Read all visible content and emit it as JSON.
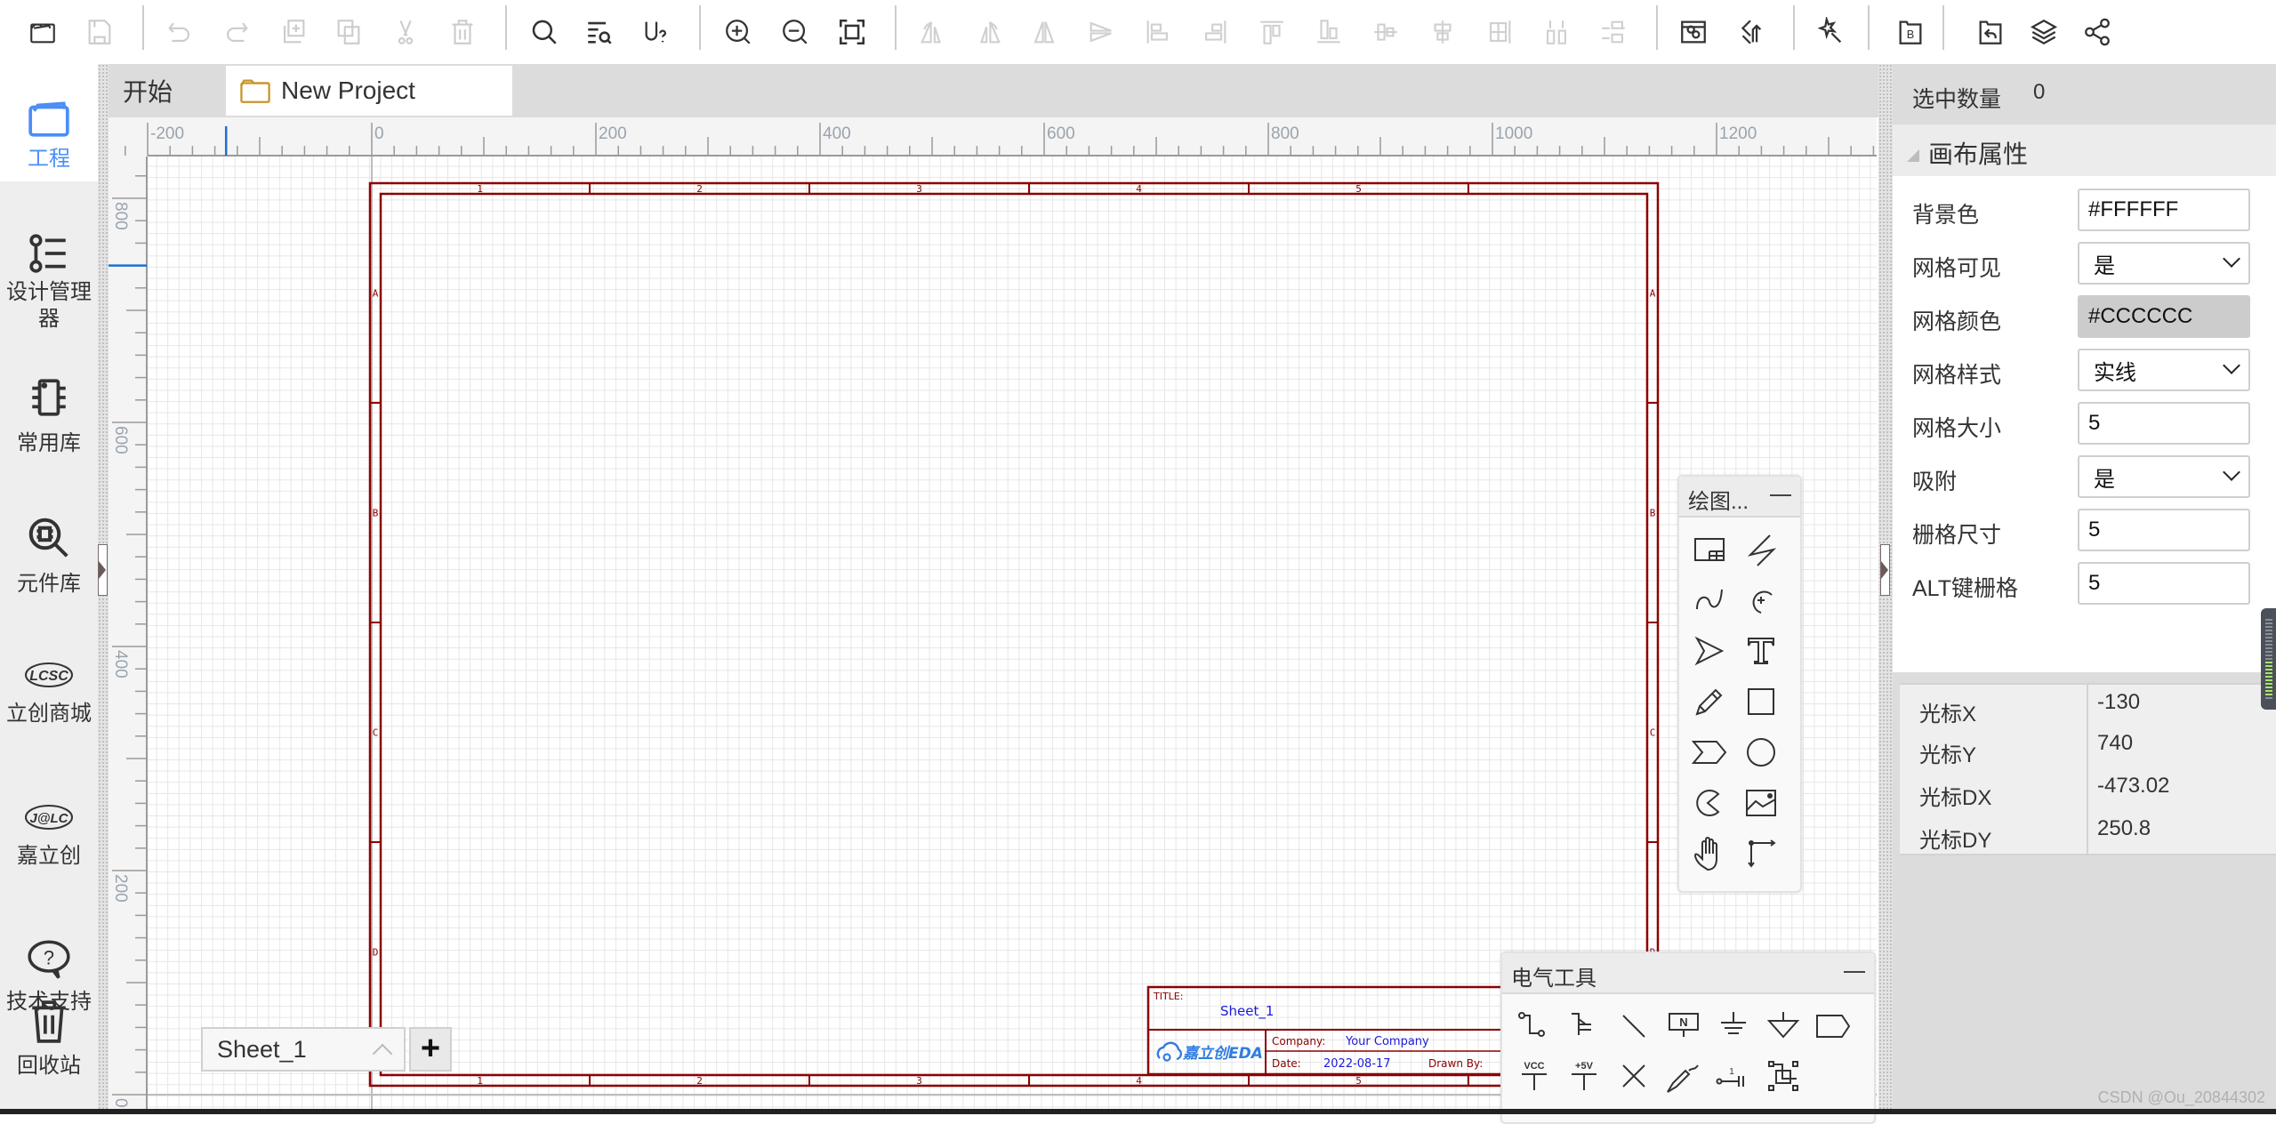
{
  "toolbar": {
    "groups": [
      [
        "folder-open-icon",
        "save-icon"
      ],
      [
        "undo-icon",
        "redo-icon",
        "duplicate-icon",
        "copy-icon",
        "cut-icon",
        "delete-icon"
      ],
      [
        "search-icon",
        "find-component-icon",
        "unknown-symbol-icon"
      ],
      [
        "zoom-in-icon",
        "zoom-out-icon",
        "fit-view-icon"
      ],
      [
        "rotate-left-icon",
        "rotate-right-icon",
        "flip-horizontal-icon",
        "flip-vertical-icon",
        "align-left-icon",
        "align-right-icon",
        "align-top-icon",
        "align-bottom-icon",
        "align-center-h-icon",
        "align-center-v-icon",
        "distribute-h-icon",
        "distribute-v-icon",
        "distribute-grid-icon"
      ],
      [
        "photo-export-icon",
        "update-layers-icon"
      ],
      [
        "magic-wand-icon"
      ],
      [
        "bom-icon"
      ],
      [
        "import-changes-icon",
        "layers-icon",
        "share-icon"
      ]
    ]
  },
  "sidebar": {
    "items": [
      {
        "label": "工程",
        "icon": "project-folder-icon",
        "active": true
      },
      {
        "label": "设计管理器",
        "icon": "design-manager-icon"
      },
      {
        "label": "常用库",
        "icon": "common-library-icon"
      },
      {
        "label": "元件库",
        "icon": "component-search-icon"
      },
      {
        "label": "立创商城",
        "icon": "lcsc-logo-icon",
        "logo_text": "LCSC"
      },
      {
        "label": "嘉立创",
        "icon": "jlc-logo-icon",
        "logo_text": "J@LC"
      },
      {
        "label": "技术支持",
        "icon": "help-bubble-icon"
      },
      {
        "label": "回收站",
        "icon": "trash-icon"
      }
    ]
  },
  "tabs": [
    {
      "label": "开始",
      "active": false
    },
    {
      "label": "New Project",
      "active": true,
      "icon": "folder-icon"
    }
  ],
  "ruler": {
    "top_labels": [
      "-200",
      "0",
      "200",
      "400",
      "600",
      "800",
      "1000",
      "1200"
    ],
    "left_labels": [
      "800",
      "600",
      "400",
      "200",
      "0"
    ]
  },
  "sheet": {
    "border_color": "#8B0000",
    "columns": [
      "1",
      "2",
      "3",
      "4",
      "5"
    ],
    "rows": [
      "A",
      "B",
      "C",
      "D"
    ],
    "title_block": {
      "title_label": "TITLE:",
      "title_value": "Sheet_1",
      "logo_text": "嘉立创EDA",
      "company_label": "Company:",
      "company_value": "Your Company",
      "date_label": "Date:",
      "date_value": "2022-08-17",
      "drawn_by_label": "Drawn By:"
    }
  },
  "drawing_tools": {
    "title": "绘图...",
    "tools": [
      "schematic-frame-icon",
      "polyline-icon",
      "bezier-icon",
      "arc-icon",
      "arrowhead-icon",
      "text-icon",
      "freehand-icon",
      "rectangle-icon",
      "chevron-shape-icon",
      "circle-icon",
      "pie-icon",
      "image-icon",
      "pan-hand-icon",
      "drag-axis-icon"
    ]
  },
  "electrical_tools": {
    "title": "电气工具",
    "tools": [
      "wire-icon",
      "bus-icon",
      "bus-entry-icon",
      "net-label-icon",
      "ground-icon",
      "net-port-ground-icon",
      "net-flag-icon",
      "vcc-icon",
      "plus5v-icon",
      "no-connect-icon",
      "probe-icon",
      "pin-icon",
      "group-icon"
    ],
    "labels": {
      "vcc": "VCC",
      "plus5v": "+5V",
      "net": "N",
      "pin_num": "1"
    }
  },
  "sheet_selector": {
    "current": "Sheet_1",
    "add_label": "+"
  },
  "properties": {
    "selected_count_label": "选中数量",
    "selected_count": "0",
    "section_title": "画布属性",
    "fields": [
      {
        "label": "背景色",
        "value": "#FFFFFF",
        "type": "text"
      },
      {
        "label": "网格可见",
        "value": "是",
        "type": "select"
      },
      {
        "label": "网格颜色",
        "value": "#CCCCCC",
        "type": "color"
      },
      {
        "label": "网格样式",
        "value": "实线",
        "type": "select"
      },
      {
        "label": "网格大小",
        "value": "5",
        "type": "text"
      },
      {
        "label": "吸附",
        "value": "是",
        "type": "select"
      },
      {
        "label": "栅格尺寸",
        "value": "5",
        "type": "text"
      },
      {
        "label": "ALT键栅格",
        "value": "5",
        "type": "text"
      }
    ],
    "cursor": [
      {
        "label": "光标X",
        "value": "-130"
      },
      {
        "label": "光标Y",
        "value": "740"
      },
      {
        "label": "光标DX",
        "value": "-473.02"
      },
      {
        "label": "光标DY",
        "value": "250.8"
      }
    ]
  },
  "watermark": "CSDN @Ou_20844302",
  "colors": {
    "accent": "#4B8EF5",
    "sheet_border": "#8B0000",
    "title_value": "#1a1adc"
  }
}
